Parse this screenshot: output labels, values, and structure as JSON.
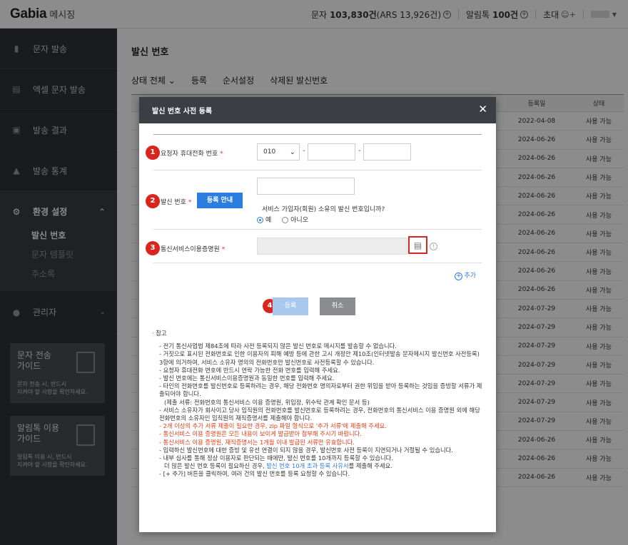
{
  "topbar": {
    "logo_main": "Gabia",
    "logo_sub": "메시징",
    "sms_label": "문자",
    "sms_count": "103,830건",
    "ars_text": "(ARS 13,926건)",
    "alimtalk_label": "알림톡",
    "alimtalk_count": "100건",
    "invite_label": "초대"
  },
  "sidebar": {
    "items": [
      {
        "label": "문자 발송",
        "icon": "mobile-icon"
      },
      {
        "label": "엑셀 문자 발송",
        "icon": "excel-icon"
      },
      {
        "label": "발송 결과",
        "icon": "result-icon"
      },
      {
        "label": "발송 통계",
        "icon": "chart-icon"
      }
    ],
    "settings": {
      "label": "환경 설정",
      "sub": [
        "발신 번호",
        "문자 템플릿",
        "주소록"
      ]
    },
    "admin_label": "관리자",
    "guide1": {
      "title": "문자 전송\n가이드",
      "desc": "문자 전송 시, 반드시\n지켜야 할 사항을 확인하세요."
    },
    "guide2": {
      "title": "알림톡 이용\n가이드",
      "desc": "알림톡 이용 시, 반드시\n지켜야 할 사항을 확인하세요."
    }
  },
  "main": {
    "title": "발신 번호",
    "tabs": [
      "상태 전체 ⌄",
      "등록",
      "순서설정",
      "삭제된 발신번호"
    ],
    "table": {
      "col_date": "등록일",
      "col_state": "상태",
      "rows": [
        {
          "date": "2022-04-08",
          "state": "사용 가능"
        },
        {
          "date": "2024-06-26",
          "state": "사용 가능"
        },
        {
          "date": "2024-06-26",
          "state": "사용 가능"
        },
        {
          "date": "2024-06-26",
          "state": "사용 가능"
        },
        {
          "date": "2024-06-26",
          "state": "사용 가능"
        },
        {
          "date": "2024-06-26",
          "state": "사용 가능"
        },
        {
          "date": "2024-06-26",
          "state": "사용 가능"
        },
        {
          "date": "2024-06-26",
          "state": "사용 가능"
        },
        {
          "date": "2024-06-26",
          "state": "사용 가능"
        },
        {
          "date": "2024-06-26",
          "state": "사용 가능"
        },
        {
          "date": "2024-07-29",
          "state": "사용 가능"
        },
        {
          "date": "2024-07-29",
          "state": "사용 가능"
        },
        {
          "date": "2024-07-29",
          "state": "사용 가능"
        },
        {
          "date": "2024-07-29",
          "state": "사용 가능"
        },
        {
          "date": "2024-07-29",
          "state": "사용 가능"
        },
        {
          "date": "2024-07-29",
          "state": "사용 가능"
        },
        {
          "date": "2024-07-29",
          "state": "사용 가능"
        },
        {
          "date": "2024-06-26",
          "state": "사용 가능"
        },
        {
          "date": "2024-06-26",
          "state": "사용 가능"
        },
        {
          "date": "2024-06-26",
          "state": "사용 가능"
        }
      ]
    }
  },
  "modal": {
    "title": "발신 번호 사전 등록",
    "row1": {
      "badge": "1",
      "label": "요청자 휴대전화 번호",
      "req": "*",
      "prefix": "010",
      "dash": "-"
    },
    "row2": {
      "badge": "2",
      "label": "발신 번호",
      "req": "*",
      "guide_btn": "등록 안내",
      "question": "서비스 가입자(회원) 소유의 발신 번호입니까?",
      "yes": "예",
      "no": "아니오"
    },
    "row3": {
      "badge": "3",
      "label": "통신서비스이용증명원",
      "req": "*"
    },
    "add_label": "추가",
    "badge4": "4",
    "submit_label": "등록",
    "cancel_label": "취소",
    "notes_title": "· 참고",
    "notes": [
      {
        "text": "- 전기 통신사업법 제84조에 따라 사전 등록되지 않은 발신 번호로 메시지를 발송할 수 없습니다.",
        "red": false
      },
      {
        "text": "- 거짓으로 표시된 전화번호로 인한 이용자의 피해 예방 등에 관한 고시 개정안 제10조(인터넷발송 문자메시지 발신번호 사전등록) 3항에 의거하여, 서비스 소유자 명의의 전화번호만 발신번호로 사전등록할 수 있습니다.",
        "red": false
      },
      {
        "text": "- 요청자 휴대전화 번호에 반드시 연락 가능한 전화 번호를 입력해 주세요.",
        "red": false
      },
      {
        "text": "- 발신 번호에는 통신서비스이용증명원과 동일한 번호를 입력해 주세요.",
        "red": false
      },
      {
        "text": "- 타인의 전화번호를 발신번호로 등록하려는 경우, 해당 전화번호 명의자로부터 권한 위임을 받아 등록하는 것임을 증빙할 서류가 제출되어야 합니다.",
        "red": false
      },
      {
        "text": "(제출 서류: 전화번호의 통신서비스 이용 증명원, 위임장, 위수탁 관계 확인 문서 등)",
        "red": false
      },
      {
        "text": "- 서비스 소유자가 회사이고 당사 임직원의 전화번호를 발신번호로 등록하려는 경우, 전화번호의 통신서비스 이용 증명원 외에 해당 전화번호의 소유자인 임직원의 재직증명서를 제출해야 합니다.",
        "red": false
      },
      {
        "text": "- 2개 이상의 추가 서류 제출이 필요한 경우, zip 파일 형식으로 '추가 서류'에 제출해 주세요.",
        "red": true
      },
      {
        "text": "- 통신서비스 이용 증명원은 모든 내용이 보이게 발급받아 첨부해 주시기 바랍니다.",
        "red": true
      },
      {
        "text": "- 통신서비스 이용 증명원, 재직증명서는 1개월 이내 발급된 서류만 유효합니다.",
        "red": true
      },
      {
        "text": "- 입력하신 발신번호에 대한 증빙 및 유선 연결이 되지 않을 경우, 발신번호 사전 등록이 지연되거나 거절될 수 있습니다.",
        "red": false
      },
      {
        "text": "- 내부 심사를 통해 정상 이용자로 판단되는 때에만, 발신 번호를 10개까지 등록할 수 있습니다.",
        "red": false
      }
    ],
    "note_more_pre": "더 많은 발신 번호 등록이 필요하신 경우, ",
    "note_more_link": "발신 번호 10개 초과 등록 사유서",
    "note_more_post": "를 제출해 주세요.",
    "note_last": "- [+ 추가] 버튼을 클릭하여, 여러 건의 발신 번호를 등록 요청할 수 있습니다."
  }
}
